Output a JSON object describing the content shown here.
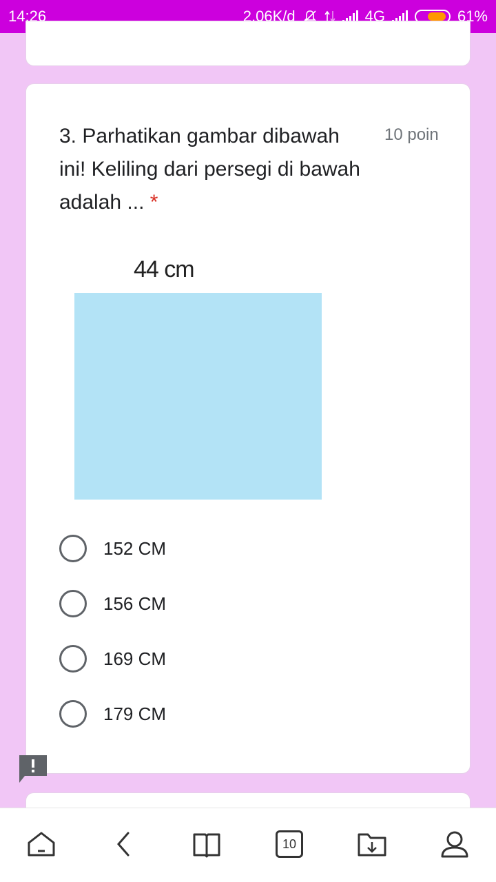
{
  "status_bar": {
    "time": "14:26",
    "speed": "2,06K/d",
    "network": "4G",
    "battery_percent": "61%",
    "battery_level": 0.61
  },
  "question": {
    "number_text": "3. Parhatikan gambar dibawah ini! Keliling dari persegi di bawah adalah ...",
    "required_mark": "*",
    "points": "10 poin"
  },
  "figure": {
    "side_label": "44 cm",
    "square_color": "#b3e3f6"
  },
  "options": [
    {
      "label": "152 CM"
    },
    {
      "label": "156 CM"
    },
    {
      "label": "169 CM"
    },
    {
      "label": "179 CM"
    }
  ],
  "navbar": {
    "tab_count": "10",
    "icons": [
      "home-icon",
      "back-icon",
      "bookmarks-icon",
      "tabs-icon",
      "downloads-icon",
      "profile-icon"
    ]
  },
  "colors": {
    "status_bar": "#cc00dd",
    "page_background": "#f1c6f6",
    "required": "#d93025"
  }
}
